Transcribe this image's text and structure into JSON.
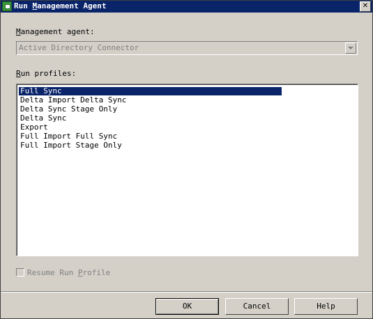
{
  "window": {
    "title_prefix": "Run ",
    "title_mnemonic": "M",
    "title_suffix": "anagement Agent",
    "close_symbol": "✕"
  },
  "management_agent": {
    "label_mnemonic": "M",
    "label_rest": "anagement agent:",
    "selected_value": "Active Directory Connector"
  },
  "run_profiles": {
    "label_mnemonic": "R",
    "label_rest": "un profiles:",
    "items": [
      "Full Sync",
      "Delta Import Delta Sync",
      "Delta Sync Stage Only",
      "Delta Sync",
      "Export",
      "Full Import Full Sync",
      "Full Import Stage Only"
    ],
    "selected_index": 0
  },
  "resume_checkbox": {
    "label_prefix": "Resume Run ",
    "label_mnemonic": "P",
    "label_suffix": "rofile",
    "checked": false
  },
  "buttons": {
    "ok": "OK",
    "cancel": "Cancel",
    "help": "Help"
  },
  "colors": {
    "titlebar": "#0a246a",
    "dialog_bg": "#d4d0c8",
    "selection": "#0a246a",
    "disabled_text": "#808080"
  }
}
